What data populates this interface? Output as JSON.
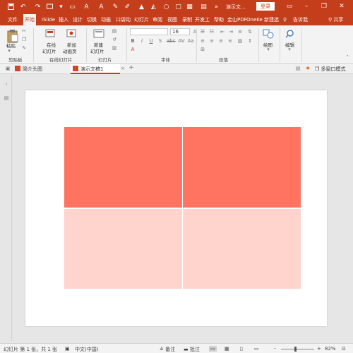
{
  "colors": {
    "accent": "#c43e1c",
    "ribbon_bg": "#f3f3f3",
    "table_header_fill": "#ff7360",
    "table_body_fill": "#ffd4cd"
  },
  "titlebar": {
    "doc_title": "演示文...",
    "login_label": "登录",
    "quick_access": [
      "save-icon",
      "undo-icon",
      "redo-icon",
      "present-icon"
    ]
  },
  "ribbon_tabs": [
    "文件",
    "开始",
    "iSlide",
    "插入",
    "设计",
    "切换",
    "动画",
    "口袋动",
    "幻灯片",
    "审阅",
    "视图",
    "录制",
    "开发工",
    "帮助",
    "金山PDF",
    "OneKe",
    "新建选",
    "告诉我",
    "共享"
  ],
  "ribbon": {
    "clipboard": {
      "paste_label": "粘贴",
      "group_label": "剪贴板"
    },
    "online_slides": {
      "online_label_1": "在线",
      "online_label_2": "幻灯片",
      "new_anim_label_1": "新加",
      "new_anim_label_2": "动画页",
      "group_label": "在线幻灯片"
    },
    "slides": {
      "new_label_1": "新建",
      "new_label_2": "幻灯片",
      "group_label": "幻灯片"
    },
    "font": {
      "size_value": "16",
      "group_label": "字体",
      "format_buttons": [
        "B",
        "I",
        "U",
        "S",
        "abc",
        "AV",
        "Aa",
        "A"
      ]
    },
    "paragraph": {
      "group_label": "段落"
    },
    "drawing": {
      "label": "绘图"
    },
    "editing": {
      "label": "编辑"
    }
  },
  "doc_tabs": [
    {
      "label": "简介头图"
    },
    {
      "label": "演示文稿1"
    }
  ],
  "doc_tab_right": {
    "multi_window_label": "多窗口模式"
  },
  "table": {
    "rows": 2,
    "cols": 2
  },
  "statusbar": {
    "slide_info": "幻灯片 第 1 张，共 1 张",
    "language": "中文(中国)",
    "notes_label": "备注",
    "comments_label": "批注",
    "zoom": "82%",
    "zoom_minus": "-",
    "zoom_plus": "+"
  }
}
